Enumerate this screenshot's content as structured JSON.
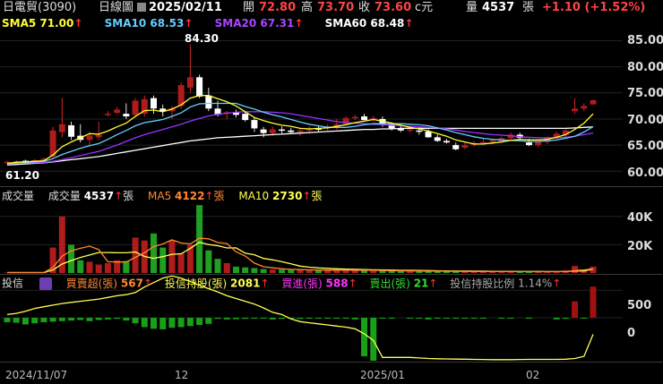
{
  "header": {
    "stock": "日電貿(3090)",
    "period": "日線圖",
    "date": "2025/02/11",
    "open_label": "開",
    "open": "72.80",
    "high_label": "高",
    "high": "73.70",
    "close_label": "收",
    "close": "73.60",
    "currency": "c元",
    "vol_label": "量",
    "vol": "4537",
    "vol_unit": "張",
    "change": "+1.10 (+1.52%)"
  },
  "colors": {
    "up": "#b01c1c",
    "down": "#20a020",
    "sma5": "#ffff33",
    "sma10": "#66ccff",
    "sma20": "#9933ff",
    "sma60": "#ffffff",
    "orange": "#ff8833",
    "yellow": "#ffff55",
    "magenta": "#ff33ff",
    "green": "#33dd33"
  },
  "price_legend": [
    {
      "label": "SMA5",
      "value": "71.00",
      "arrow": "↑",
      "color": "#ffff33"
    },
    {
      "label": "SMA10",
      "value": "68.53",
      "arrow": "↑",
      "color": "#66ccff"
    },
    {
      "label": "SMA20",
      "value": "67.31",
      "arrow": "↑",
      "color": "#9933ff"
    },
    {
      "label": "SMA60",
      "value": "68.48",
      "arrow": "↑",
      "color": "#ffffff"
    }
  ],
  "volume_legend": {
    "title": "成交量",
    "vol_label": "成交量",
    "vol": "4537",
    "unit": "張",
    "ma5_label": "MA5",
    "ma5": "4122",
    "ma10_label": "MA10",
    "ma10": "2730",
    "arrow": "↑"
  },
  "inst_legend": {
    "title": "投信",
    "net_label": "買賣超(張)",
    "net": "567",
    "hold_label": "投信持股(張)",
    "hold": "2081",
    "buy_label": "買進(張)",
    "buy": "588",
    "sell_label": "賣出(張)",
    "sell": "21",
    "ratio_label": "投信持股比例",
    "ratio": "1.14%",
    "arrow": "↑"
  },
  "chart_data": {
    "type": "candlestick",
    "price_axis": {
      "ticks": [
        "85.00",
        "80.00",
        "75.00",
        "70.00",
        "65.00",
        "60.00"
      ],
      "range": [
        58.5,
        88
      ]
    },
    "annotations": {
      "max": "84.30",
      "min": "61.20"
    },
    "x_ticks": [
      "2024/11/07",
      "12",
      "2025/01",
      "02"
    ],
    "volume_axis": {
      "ticks": [
        "40K",
        "20K"
      ],
      "range": [
        0,
        50000
      ]
    },
    "inst_axis": {
      "ticks": [
        "500",
        "0"
      ],
      "range": [
        -780,
        700
      ]
    },
    "ohlc": [
      [
        61.6,
        62.0,
        61.2,
        61.8
      ],
      [
        61.8,
        62.1,
        61.5,
        61.9
      ],
      [
        62.0,
        62.2,
        61.7,
        61.8
      ],
      [
        61.9,
        62.3,
        61.8,
        62.1
      ],
      [
        62.2,
        62.6,
        62.0,
        62.4
      ],
      [
        62.8,
        68.5,
        62.5,
        67.8
      ],
      [
        67.5,
        74.0,
        66.5,
        69.0
      ],
      [
        68.8,
        69.5,
        66.0,
        66.6
      ],
      [
        66.8,
        69.0,
        65.5,
        66.0
      ],
      [
        66.0,
        67.5,
        65.0,
        66.8
      ],
      [
        66.5,
        69.5,
        66.0,
        67.0
      ],
      [
        71.0,
        71.5,
        70.5,
        71.0
      ],
      [
        71.2,
        72.3,
        71.0,
        71.8
      ],
      [
        71.0,
        73.0,
        70.0,
        70.5
      ],
      [
        70.8,
        74.0,
        70.3,
        73.5
      ],
      [
        71.0,
        74.5,
        70.5,
        73.8
      ],
      [
        74.0,
        74.5,
        71.0,
        72.0
      ],
      [
        72.0,
        72.8,
        70.5,
        71.5
      ],
      [
        71.5,
        72.5,
        70.0,
        72.0
      ],
      [
        72.5,
        77.0,
        72.0,
        76.5
      ],
      [
        76.0,
        84.3,
        75.0,
        78.0
      ],
      [
        78.0,
        78.5,
        74.0,
        74.3
      ],
      [
        74.5,
        76.0,
        71.5,
        72.0
      ],
      [
        72.0,
        73.5,
        70.5,
        70.8
      ],
      [
        71.0,
        71.5,
        70.0,
        71.3
      ],
      [
        71.3,
        71.8,
        70.3,
        70.8
      ],
      [
        71.0,
        71.5,
        69.5,
        69.8
      ],
      [
        69.8,
        70.3,
        67.5,
        68.2
      ],
      [
        68.0,
        68.5,
        66.5,
        67.3
      ],
      [
        67.3,
        68.5,
        66.8,
        68.0
      ],
      [
        68.0,
        68.6,
        67.2,
        67.8
      ],
      [
        67.8,
        68.3,
        67.2,
        67.5
      ],
      [
        67.5,
        68.2,
        66.8,
        67.8
      ],
      [
        67.8,
        68.6,
        67.2,
        68.2
      ],
      [
        68.2,
        68.8,
        67.6,
        68.0
      ],
      [
        68.2,
        69.0,
        67.8,
        68.6
      ],
      [
        68.6,
        70.0,
        68.0,
        69.0
      ],
      [
        69.0,
        70.5,
        68.8,
        70.2
      ],
      [
        70.2,
        70.8,
        69.8,
        70.4
      ],
      [
        70.5,
        71.0,
        69.8,
        69.8
      ],
      [
        70.0,
        70.6,
        69.5,
        70.2
      ],
      [
        70.0,
        70.5,
        68.5,
        69.0
      ],
      [
        69.0,
        69.4,
        67.8,
        68.2
      ],
      [
        68.2,
        68.8,
        67.5,
        67.8
      ],
      [
        67.8,
        68.5,
        67.4,
        68.0
      ],
      [
        67.8,
        68.4,
        67.0,
        67.6
      ],
      [
        67.6,
        68.0,
        66.4,
        66.5
      ],
      [
        66.5,
        67.0,
        65.6,
        65.8
      ],
      [
        65.8,
        66.2,
        65.3,
        65.5
      ],
      [
        65.0,
        65.5,
        64.0,
        64.2
      ],
      [
        64.5,
        65.5,
        64.2,
        65.0
      ],
      [
        65.0,
        65.8,
        64.7,
        65.4
      ],
      [
        65.4,
        66.2,
        65.0,
        65.6
      ],
      [
        65.6,
        66.2,
        65.2,
        65.9
      ],
      [
        65.6,
        66.6,
        65.4,
        66.3
      ],
      [
        66.3,
        67.4,
        65.9,
        67.0
      ],
      [
        67.0,
        67.4,
        66.2,
        66.4
      ],
      [
        65.5,
        66.2,
        64.8,
        65.0
      ],
      [
        65.0,
        65.8,
        64.6,
        65.6
      ],
      [
        65.6,
        66.6,
        65.2,
        66.5
      ],
      [
        66.5,
        67.6,
        66.2,
        67.2
      ],
      [
        67.0,
        68.0,
        66.5,
        67.8
      ],
      [
        71.5,
        74.0,
        71.0,
        72.0
      ],
      [
        72.0,
        73.0,
        71.5,
        72.5
      ],
      [
        72.8,
        73.7,
        72.8,
        73.6
      ]
    ],
    "sma5": [
      61.5,
      61.7,
      61.8,
      61.9,
      62.0,
      63.1,
      64.7,
      65.6,
      66.4,
      67.2,
      67.1,
      67.7,
      68.5,
      69.2,
      70.5,
      71.6,
      71.7,
      71.4,
      71.9,
      72.7,
      74.0,
      74.5,
      74.5,
      73.9,
      73.3,
      72.5,
      71.4,
      70.3,
      69.7,
      69.2,
      68.8,
      68.6,
      68.2,
      68.1,
      68.2,
      68.3,
      68.6,
      68.9,
      69.3,
      69.6,
      69.9,
      69.6,
      69.2,
      68.8,
      68.4,
      68.1,
      67.7,
      67.2,
      66.7,
      66.0,
      65.6,
      65.2,
      65.2,
      65.4,
      65.6,
      65.9,
      66.1,
      66.0,
      66.0,
      66.1,
      66.5,
      67.0,
      68.0,
      69.2,
      71.0
    ],
    "sma10": [
      61.5,
      61.6,
      61.7,
      61.8,
      61.9,
      62.4,
      63.2,
      63.8,
      64.4,
      64.9,
      65.3,
      66.1,
      67.0,
      67.8,
      68.7,
      69.3,
      69.6,
      69.9,
      70.5,
      71.2,
      72.3,
      72.9,
      73.0,
      73.0,
      73.0,
      73.0,
      72.4,
      71.9,
      71.3,
      70.8,
      70.4,
      69.9,
      69.4,
      69.0,
      68.7,
      68.4,
      68.4,
      68.4,
      68.6,
      68.9,
      69.1,
      69.1,
      69.1,
      69.1,
      69.0,
      68.9,
      68.7,
      68.3,
      67.9,
      67.4,
      67.0,
      66.6,
      66.3,
      66.1,
      66.0,
      65.9,
      65.8,
      65.7,
      65.7,
      65.8,
      66.0,
      66.3,
      66.7,
      67.5,
      68.53
    ],
    "sma20": [
      61.5,
      61.5,
      61.6,
      61.6,
      61.7,
      61.9,
      62.2,
      62.6,
      63.0,
      63.4,
      63.8,
      64.4,
      65.0,
      65.7,
      66.4,
      67.0,
      67.5,
      68.0,
      68.5,
      69.0,
      69.6,
      70.1,
      70.6,
      70.9,
      71.1,
      71.3,
      71.4,
      71.4,
      71.4,
      71.3,
      71.2,
      71.0,
      70.7,
      70.4,
      70.1,
      69.8,
      69.5,
      69.3,
      69.2,
      69.1,
      69.0,
      68.9,
      68.8,
      68.7,
      68.6,
      68.5,
      68.4,
      68.3,
      68.1,
      67.9,
      67.6,
      67.4,
      67.2,
      67.0,
      66.9,
      66.8,
      66.6,
      66.5,
      66.4,
      66.4,
      66.4,
      66.5,
      66.7,
      67.0,
      67.31
    ],
    "sma60": [
      61.2,
      61.3,
      61.4,
      61.5,
      61.6,
      61.8,
      62.0,
      62.2,
      62.4,
      62.6,
      62.8,
      63.1,
      63.4,
      63.7,
      64.0,
      64.3,
      64.6,
      64.9,
      65.2,
      65.5,
      65.8,
      66.0,
      66.2,
      66.4,
      66.5,
      66.6,
      66.7,
      66.8,
      66.9,
      67.0,
      67.1,
      67.2,
      67.3,
      67.4,
      67.5,
      67.6,
      67.7,
      67.8,
      67.9,
      68.0,
      68.0,
      68.1,
      68.1,
      68.2,
      68.2,
      68.2,
      68.2,
      68.2,
      68.2,
      68.2,
      68.2,
      68.2,
      68.2,
      68.2,
      68.2,
      68.2,
      68.2,
      68.2,
      68.2,
      68.2,
      68.2,
      68.2,
      68.3,
      68.4,
      68.48
    ],
    "volume": [
      300,
      350,
      300,
      250,
      400,
      18000,
      40000,
      20000,
      9000,
      8000,
      6000,
      7000,
      9000,
      8500,
      25000,
      23000,
      28000,
      18000,
      23000,
      14000,
      20000,
      48000,
      16000,
      10000,
      7000,
      4500,
      4000,
      3500,
      2800,
      2500,
      2400,
      2200,
      2100,
      2000,
      1800,
      1900,
      2100,
      2200,
      2000,
      1800,
      1700,
      1600,
      1500,
      1400,
      1400,
      1300,
      1200,
      1200,
      1100,
      1100,
      1000,
      1000,
      1000,
      1100,
      1100,
      1000,
      900,
      900,
      900,
      900,
      1000,
      1800,
      5000,
      2500,
      4537
    ],
    "vol_ma5": [
      300,
      320,
      320,
      300,
      320,
      3900,
      11900,
      15700,
      17500,
      19000,
      16600,
      8000,
      7800,
      7700,
      11100,
      14300,
      18700,
      20500,
      23400,
      21200,
      20600,
      24600,
      24200,
      21600,
      20800,
      15000,
      12000,
      7000,
      4400,
      3700,
      3000,
      2600,
      2400,
      2200,
      2100,
      2000,
      2000,
      2000,
      2000,
      1960,
      1960,
      1860,
      1720,
      1600,
      1520,
      1440,
      1360,
      1300,
      1240,
      1180,
      1120,
      1080,
      1060,
      1040,
      1040,
      1040,
      1000,
      980,
      960,
      920,
      920,
      1100,
      1720,
      2240,
      2967
    ],
    "vol_ma10": [
      300,
      320,
      320,
      300,
      320,
      2100,
      6300,
      8800,
      11000,
      12700,
      14500,
      14500,
      14300,
      14300,
      14900,
      11700,
      10400,
      11600,
      13200,
      13600,
      17500,
      21700,
      20100,
      19300,
      17700,
      17800,
      14000,
      12900,
      10300,
      9300,
      8000,
      6500,
      4900,
      4100,
      3600,
      3300,
      3000,
      2800,
      2600,
      2400,
      2300,
      2200,
      2100,
      1900,
      1900,
      1800,
      1700,
      1600,
      1500,
      1400,
      1400,
      1300,
      1300,
      1200,
      1200,
      1200,
      1100,
      1100,
      1100,
      1000,
      1000,
      1100,
      1300,
      1500,
      2730
    ],
    "inst_net": [
      -80,
      -90,
      -120,
      -100,
      -80,
      -70,
      -60,
      -50,
      -40,
      -60,
      -40,
      -30,
      -20,
      -50,
      -100,
      -170,
      -200,
      -210,
      -180,
      -170,
      -150,
      -130,
      -110,
      -20,
      -30,
      -25,
      -20,
      -10,
      -10,
      -30,
      -20,
      -15,
      -20,
      -15,
      -10,
      -5,
      -5,
      -10,
      -30,
      -700,
      -780,
      -10,
      -10,
      0,
      -5,
      -5,
      -30,
      -10,
      -10,
      -5,
      -5,
      -5,
      -5,
      0,
      -5,
      -5,
      0,
      -5,
      0,
      0,
      -30,
      -20,
      300,
      -10,
      567
    ],
    "inst_hold": [
      60,
      80,
      120,
      170,
      200,
      230,
      260,
      280,
      300,
      320,
      340,
      370,
      400,
      420,
      460,
      560,
      640,
      720,
      760,
      720,
      660,
      590,
      530,
      470,
      400,
      350,
      300,
      250,
      180,
      100,
      60,
      -20,
      -70,
      -90,
      -110,
      -130,
      -150,
      -170,
      -200,
      -290,
      -410,
      -720,
      -720,
      -720,
      -720,
      -730,
      -740,
      -745,
      -748,
      -750,
      -752,
      -755,
      -758,
      -760,
      -760,
      -760,
      -758,
      -755,
      -755,
      -755,
      -755,
      -752,
      -740,
      -700,
      -300
    ]
  }
}
